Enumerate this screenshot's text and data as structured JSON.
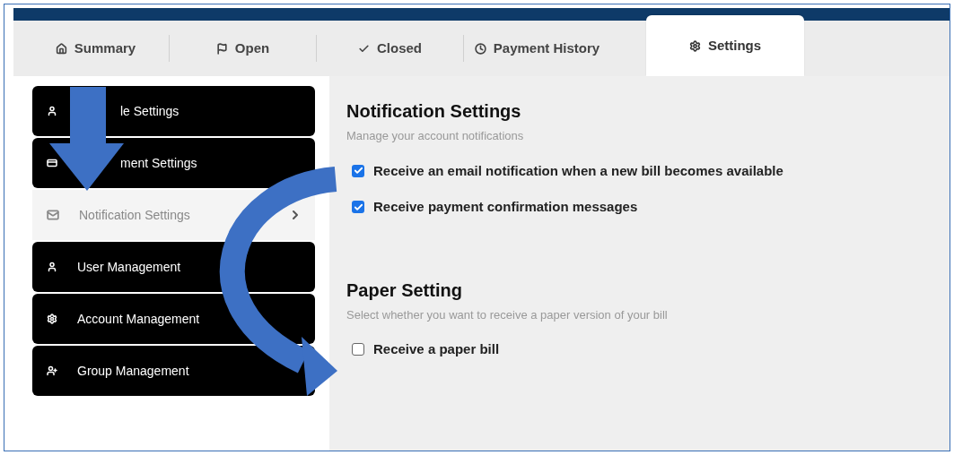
{
  "tabs": [
    {
      "label": "Summary",
      "selected": false
    },
    {
      "label": "Open",
      "selected": false
    },
    {
      "label": "Closed",
      "selected": false
    },
    {
      "label": "Payment History",
      "selected": false
    },
    {
      "label": "Settings",
      "selected": true
    }
  ],
  "sidebar": {
    "items": [
      {
        "label": "le Settings",
        "selected": false
      },
      {
        "label": "ment Settings",
        "selected": false
      },
      {
        "label": "Notification Settings",
        "selected": true
      },
      {
        "label": "User Management",
        "selected": false
      },
      {
        "label": "Account Management",
        "selected": false
      },
      {
        "label": "Group Management",
        "selected": false
      }
    ]
  },
  "sections": [
    {
      "title": "Notification Settings",
      "subtitle": "Manage your account notifications",
      "options": [
        {
          "label": "Receive an email notification when a new bill becomes available",
          "checked": true
        },
        {
          "label": "Receive payment confirmation messages",
          "checked": true
        }
      ]
    },
    {
      "title": "Paper Setting",
      "subtitle": "Select whether you want to receive a paper version of your bill",
      "options": [
        {
          "label": "Receive a paper bill",
          "checked": false
        }
      ]
    }
  ]
}
